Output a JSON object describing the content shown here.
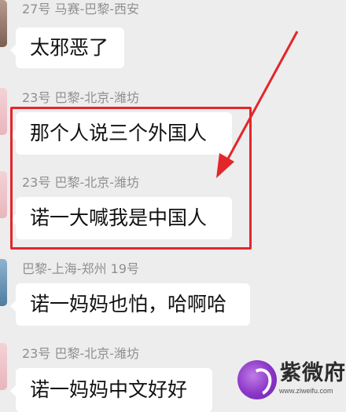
{
  "chat": {
    "messages": [
      {
        "sender": "27号 马赛-巴黎-西安",
        "text": "太邪恶了"
      },
      {
        "sender": "23号 巴黎-北京-潍坊",
        "text": "那个人说三个外国人"
      },
      {
        "sender": "23号 巴黎-北京-潍坊",
        "text": "诺一大喊我是中国人"
      },
      {
        "sender": "巴黎-上海-郑州 19号",
        "text": "诺一妈妈也怕，哈啊哈"
      },
      {
        "sender": "23号 巴黎-北京-潍坊",
        "text": "诺一妈妈中文好好"
      }
    ]
  },
  "annotation": {
    "color": "#e3262b"
  },
  "watermark": {
    "title": "紫微府",
    "url": "www.ziweifu.com"
  }
}
